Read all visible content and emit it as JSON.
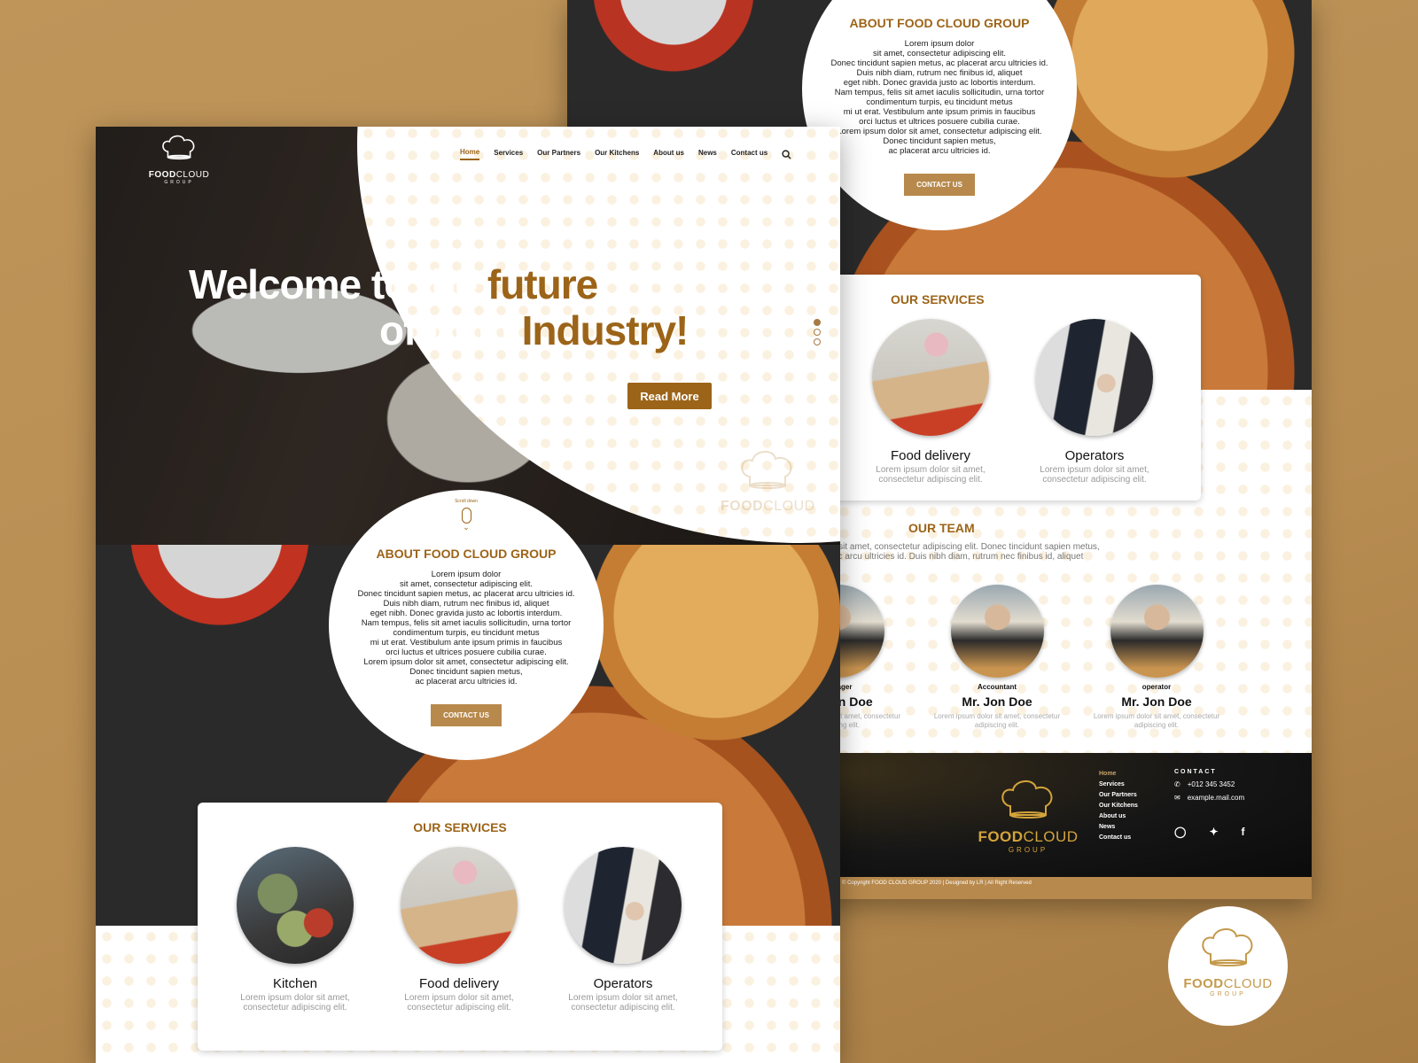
{
  "brand": {
    "name_bold": "FOOD",
    "name_light": "CLOUD",
    "sub": "GROUP",
    "accent": "#9c6418",
    "button": "#b8894c",
    "background": "#bf955a"
  },
  "nav": {
    "items": [
      "Home",
      "Services",
      "Our Partners",
      "Our Kitchens",
      "About us",
      "News",
      "Contact us"
    ],
    "active": "Home",
    "search_icon": "search-icon"
  },
  "hero": {
    "line1_white": "Welcome to the",
    "line1_gold": "future",
    "line2_white": "of food",
    "line2_gold": "Industry!",
    "cta": "Read More",
    "slides_total": 3,
    "slide_active": 1
  },
  "scroll": {
    "label": "Scroll down"
  },
  "about": {
    "title": "ABOUT FOOD CLOUD GROUP",
    "body": "Lorem ipsum dolor\nsit amet, consectetur adipiscing elit.\nDonec tincidunt sapien metus, ac placerat arcu ultricies id.\nDuis nibh diam, rutrum nec finibus id, aliquet\neget nibh. Donec gravida justo ac lobortis  interdum.\nNam tempus, felis sit amet  iaculis sollicitudin, urna tortor\ncondimentum turpis, eu tincidunt metus\nmi ut erat. Vestibulum ante ipsum primis  in faucibus\norci luctus et ultrices posuere cubilia curae.\nLorem ipsum dolor sit amet, consectetur adipiscing elit.\nDonec tincidunt sapien metus,\nac placerat arcu ultricies id.",
    "cta": "CONTACT US"
  },
  "services": {
    "title": "OUR SERVICES",
    "items": [
      {
        "title": "Kitchen",
        "desc": "Lorem ipsum dolor sit amet,\nconsectetur  adipiscing elit."
      },
      {
        "title": "Food delivery",
        "desc": "Lorem ipsum dolor sit amet,\nconsectetur  adipiscing elit."
      },
      {
        "title": "Operators",
        "desc": "Lorem ipsum dolor sit amet,\nconsectetur  adipiscing elit."
      }
    ]
  },
  "team": {
    "title": "OUR TEAM",
    "desc": "r sit amet, consectetur  adipiscing elit. Donec tincidunt sapien metus, ac arcu ultricies id. Duis nibh diam, rutrum nec finibus id, aliquet",
    "members": [
      {
        "role": "Manager",
        "name": "Mr. Jon Doe",
        "desc": "Lorem ipsum dolor sit amet, consectetur adipiscing elit."
      },
      {
        "role": "Accountant",
        "name": "Mr. Jon Doe",
        "desc": "Lorem ipsum dolor sit amet, consectetur adipiscing elit."
      },
      {
        "role": "operator",
        "name": "Mr. Jon Doe",
        "desc": "Lorem ipsum dolor sit amet, consectetur adipiscing elit."
      }
    ]
  },
  "footer": {
    "links": [
      "Home",
      "Services",
      "Our Partners",
      "Our Kitchens",
      "About us",
      "News",
      "Contact us"
    ],
    "contact_title": "CONTACT",
    "phone": "+012 345 3452",
    "email": "example.mail.com",
    "social": [
      "instagram-icon",
      "twitter-icon",
      "facebook-icon"
    ],
    "copyright": "© Copyright FOOD CLOUD GROUP 2020 | Designed by LR | All Right Reserved"
  }
}
